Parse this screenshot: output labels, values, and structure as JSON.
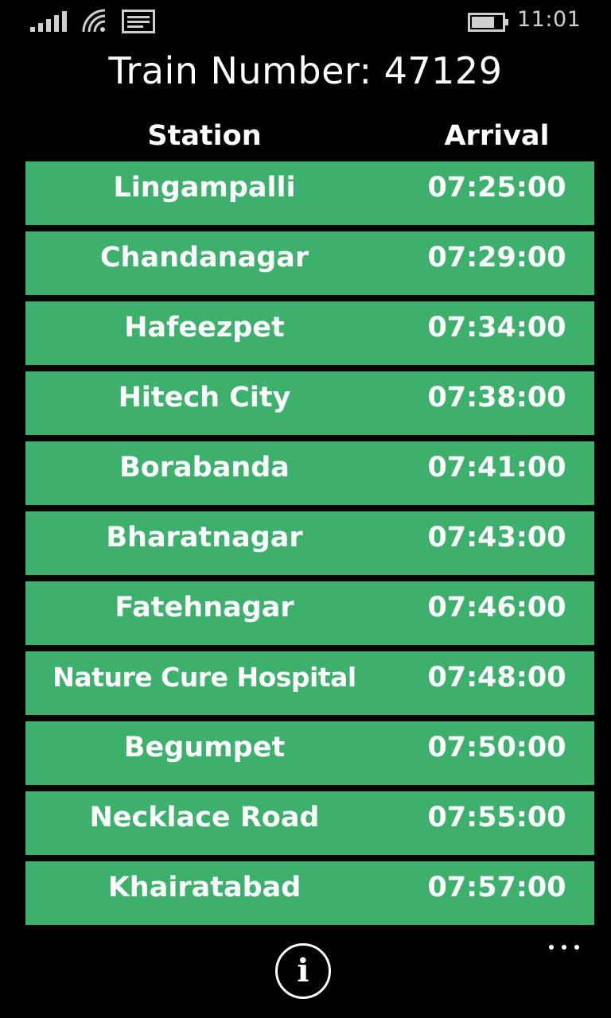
{
  "status_bar": {
    "time": "11:01",
    "signal_icon": "signal-strength-icon",
    "wifi_icon": "wifi-icon",
    "message_icon": "message-icon",
    "battery_icon": "battery-icon",
    "battery_level": 0.75
  },
  "page": {
    "title": "Train Number: 47129"
  },
  "table": {
    "headers": {
      "station": "Station",
      "arrival": "Arrival"
    },
    "rows": [
      {
        "station": "Lingampalli",
        "arrival": "07:25:00"
      },
      {
        "station": "Chandanagar",
        "arrival": "07:29:00"
      },
      {
        "station": "Hafeezpet",
        "arrival": "07:34:00"
      },
      {
        "station": "Hitech City",
        "arrival": "07:38:00"
      },
      {
        "station": "Borabanda",
        "arrival": "07:41:00"
      },
      {
        "station": "Bharatnagar",
        "arrival": "07:43:00"
      },
      {
        "station": "Fatehnagar",
        "arrival": "07:46:00"
      },
      {
        "station": "Nature Cure Hospital",
        "arrival": "07:48:00"
      },
      {
        "station": "Begumpet",
        "arrival": "07:50:00"
      },
      {
        "station": "Necklace Road",
        "arrival": "07:55:00"
      },
      {
        "station": "Khairatabad",
        "arrival": "07:57:00"
      }
    ]
  },
  "app_bar": {
    "info_glyph": "i",
    "info_icon": "info-icon",
    "more_icon": "more-ellipsis-icon"
  },
  "colors": {
    "background": "#000000",
    "row_background": "#3db06e",
    "text": "#ffffff"
  }
}
